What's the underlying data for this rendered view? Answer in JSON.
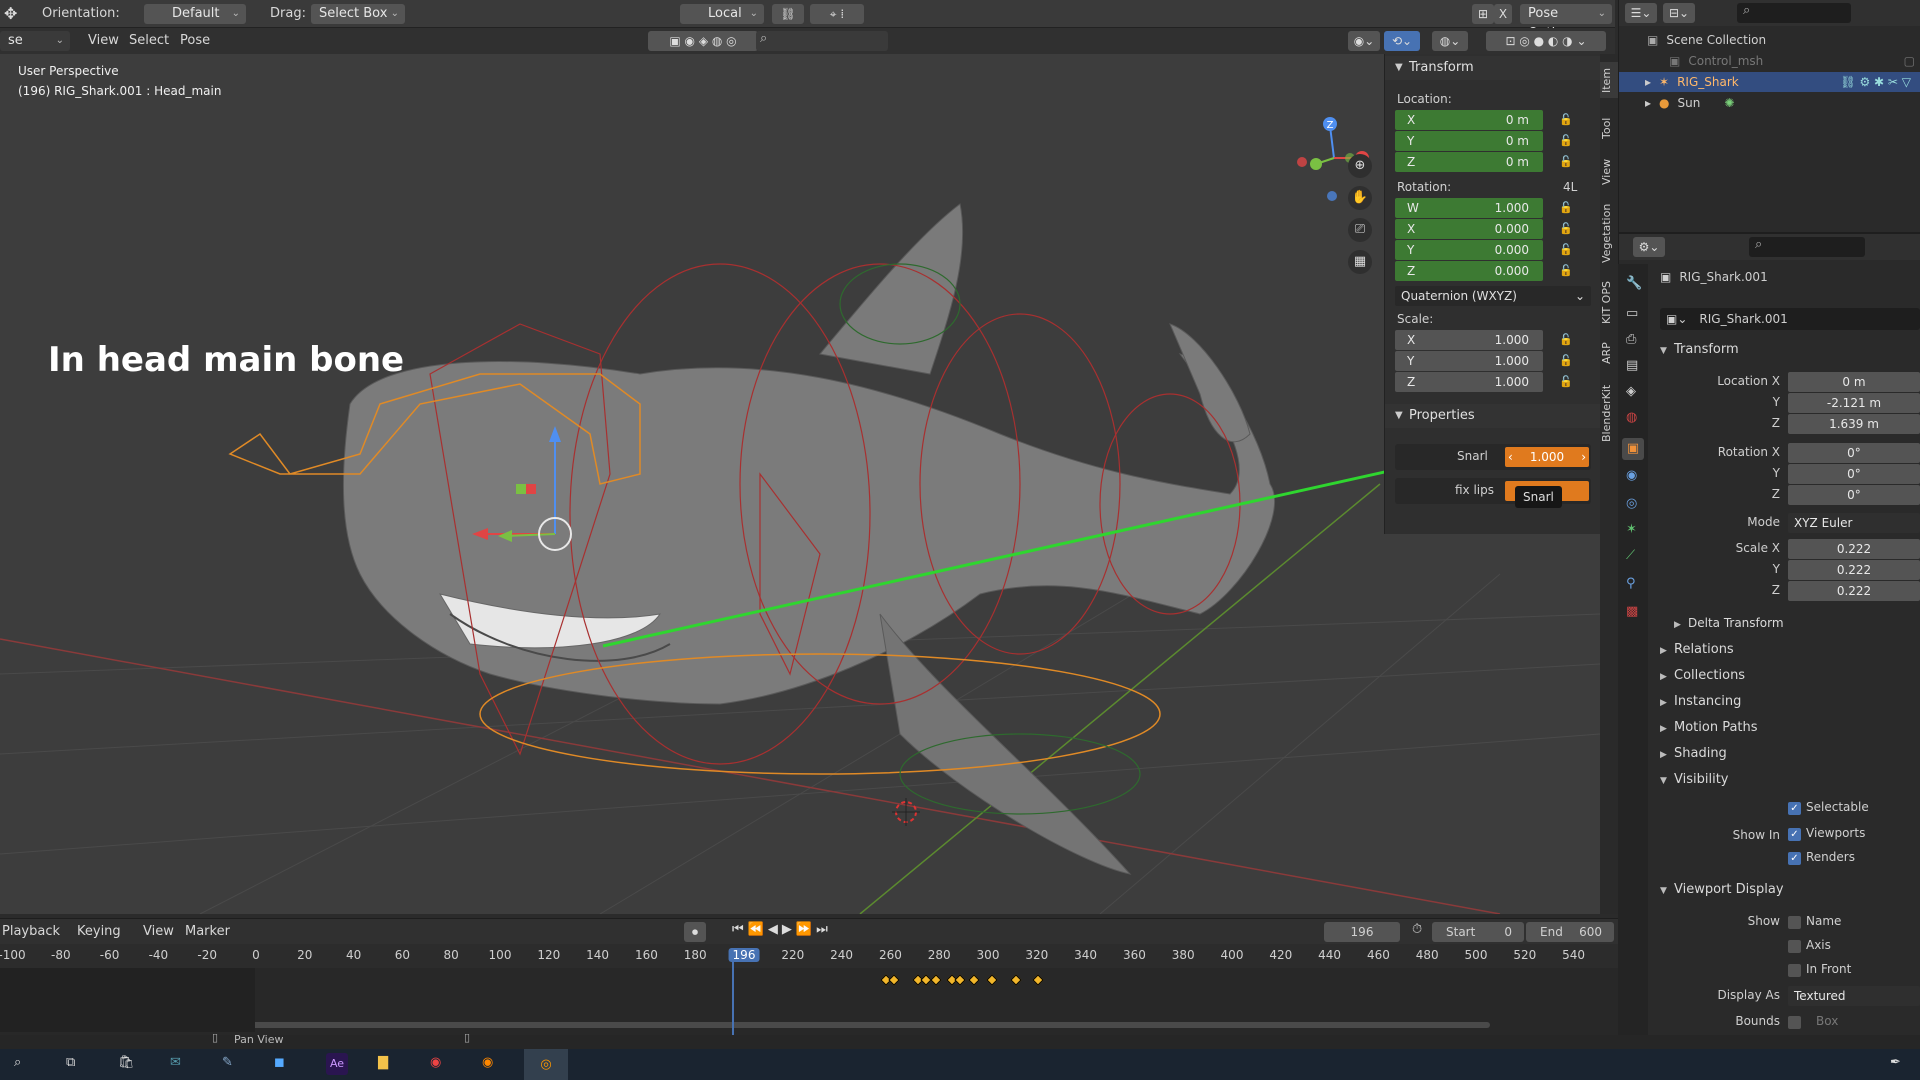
{
  "header": {
    "mode": "se Mode",
    "orientation_label": "Orientation:",
    "orientation_value": "Default",
    "drag_label": "Drag:",
    "drag_value": "Select Box",
    "pivot_value": "Local",
    "pose_options": "Pose Options",
    "x_mirror": "X",
    "menus": [
      "View",
      "Select",
      "Pose"
    ]
  },
  "viewport": {
    "perspective": "User Perspective",
    "object_info": "(196) RIG_Shark.001 : Head_main",
    "annotation": "In head main bone",
    "gizmo_axes": [
      "Z",
      "X"
    ]
  },
  "n_tabs": [
    "Item",
    "Tool",
    "View",
    "Vegetation",
    "KIT OPS",
    "ARP",
    "BlenderKit"
  ],
  "npanel": {
    "transform_title": "Transform",
    "location_label": "Location:",
    "location": [
      {
        "k": "X",
        "v": "0 m"
      },
      {
        "k": "Y",
        "v": "0 m"
      },
      {
        "k": "Z",
        "v": "0 m"
      }
    ],
    "rotation_label": "Rotation:",
    "rotation_mode_badge": "4L",
    "rotation": [
      {
        "k": "W",
        "v": "1.000"
      },
      {
        "k": "X",
        "v": "0.000"
      },
      {
        "k": "Y",
        "v": "0.000"
      },
      {
        "k": "Z",
        "v": "0.000"
      }
    ],
    "rotation_mode": "Quaternion (WXYZ)",
    "scale_label": "Scale:",
    "scale": [
      {
        "k": "X",
        "v": "1.000"
      },
      {
        "k": "Y",
        "v": "1.000"
      },
      {
        "k": "Z",
        "v": "1.000"
      }
    ],
    "properties_title": "Properties",
    "snarl_label": "Snarl",
    "snarl_value": "1.000",
    "fixlips_label": "fix lips",
    "tooltip": "Snarl"
  },
  "outliner": {
    "root": "Scene Collection",
    "items": [
      {
        "name": "Control_msh",
        "dim": true
      },
      {
        "name": "RIG_Shark",
        "selected": true
      },
      {
        "name": "Sun",
        "dim": false
      }
    ]
  },
  "properties": {
    "object_name": "RIG_Shark.001",
    "data_name": "RIG_Shark.001",
    "transform_title": "Transform",
    "location_labels": [
      "Location X",
      "Y",
      "Z"
    ],
    "location_values": [
      "0 m",
      "-2.121 m",
      "1.639 m"
    ],
    "rotation_labels": [
      "Rotation X",
      "Y",
      "Z"
    ],
    "rotation_values": [
      "0°",
      "0°",
      "0°"
    ],
    "mode_label": "Mode",
    "mode_value": "XYZ Euler",
    "scale_labels": [
      "Scale X",
      "Y",
      "Z"
    ],
    "scale_values": [
      "0.222",
      "0.222",
      "0.222"
    ],
    "delta_transform": "Delta Transform",
    "sections": [
      "Relations",
      "Collections",
      "Instancing",
      "Motion Paths",
      "Shading"
    ],
    "visibility_title": "Visibility",
    "selectable": "Selectable",
    "show_in": "Show In",
    "viewports": "Viewports",
    "renders": "Renders",
    "viewport_display_title": "Viewport Display",
    "show_label": "Show",
    "name_opt": "Name",
    "axis_opt": "Axis",
    "in_front_opt": "In Front",
    "display_as_label": "Display As",
    "display_as_value": "Textured",
    "bounds_label": "Bounds",
    "bounds_value": "Box"
  },
  "timeline": {
    "menus": [
      "Playback",
      "Keying",
      "View",
      "Marker"
    ],
    "current_frame": "196",
    "start_label": "Start",
    "start_value": "0",
    "end_label": "End",
    "end_value": "600",
    "ticks": [
      "-100",
      "-80",
      "-60",
      "-40",
      "-20",
      "0",
      "20",
      "40",
      "60",
      "80",
      "100",
      "120",
      "140",
      "160",
      "180",
      "196",
      "220",
      "240",
      "260",
      "280",
      "300",
      "320",
      "340",
      "360",
      "380",
      "400",
      "420",
      "440",
      "460",
      "480",
      "500",
      "520",
      "540"
    ]
  },
  "status": {
    "pan_view": "Pan View"
  }
}
